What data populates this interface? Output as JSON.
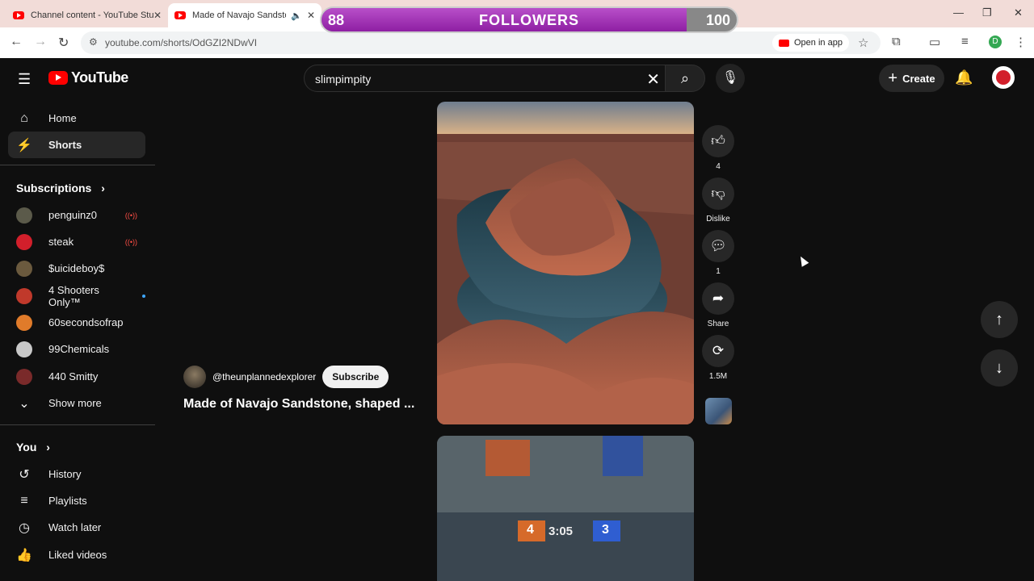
{
  "browser": {
    "tabs": [
      {
        "title": "Channel content - YouTube Stu",
        "active": false
      },
      {
        "title": "Made of Navajo Sandstone",
        "active": true
      }
    ],
    "url": "youtube.com/shorts/OdGZI2NDwVI",
    "open_in_app": "Open in app",
    "profile_initial": "D"
  },
  "overlay": {
    "followers_current": "88",
    "followers_label": "FOLLOWERS",
    "followers_goal": "100",
    "progress_fraction": 0.88
  },
  "header": {
    "logo_text": "YouTube",
    "search_query": "slimpimpity",
    "create_label": "Create"
  },
  "sidebar": {
    "main": [
      {
        "label": "Home",
        "icon": "home-icon",
        "active": false
      },
      {
        "label": "Shorts",
        "icon": "shorts-icon",
        "active": true
      }
    ],
    "subscriptions_heading": "Subscriptions",
    "subscriptions": [
      {
        "name": "penguinz0",
        "live": true,
        "color": "#5b5a4a"
      },
      {
        "name": "steak",
        "live": true,
        "color": "#d21f2b"
      },
      {
        "name": "$uicideboy$",
        "live": false,
        "color": "#6b5a3e"
      },
      {
        "name": "4 Shooters Only™",
        "live": false,
        "new": true,
        "color": "#c0392b"
      },
      {
        "name": "60secondsofrap",
        "live": false,
        "color": "#e07b2a"
      },
      {
        "name": "99Chemicals",
        "live": false,
        "color": "#c9c9c9"
      },
      {
        "name": "440 Smitty",
        "live": false,
        "color": "#7a2a2a"
      }
    ],
    "show_more": "Show more",
    "you_heading": "You",
    "you": [
      {
        "label": "History",
        "icon": "history-icon"
      },
      {
        "label": "Playlists",
        "icon": "playlists-icon"
      },
      {
        "label": "Watch later",
        "icon": "watch-later-icon"
      },
      {
        "label": "Liked videos",
        "icon": "liked-videos-icon"
      }
    ]
  },
  "short": {
    "channel": "@theunplannedexplorer",
    "subscribe": "Subscribe",
    "title": "Made of Navajo Sandstone, shaped ...",
    "actions": {
      "likes": "4",
      "dislike": "Dislike",
      "comments": "1",
      "share": "Share",
      "remix_count": "1.5M"
    }
  },
  "next_short_overlay": {
    "score_left": "4",
    "clock": "3:05",
    "score_right": "3"
  }
}
